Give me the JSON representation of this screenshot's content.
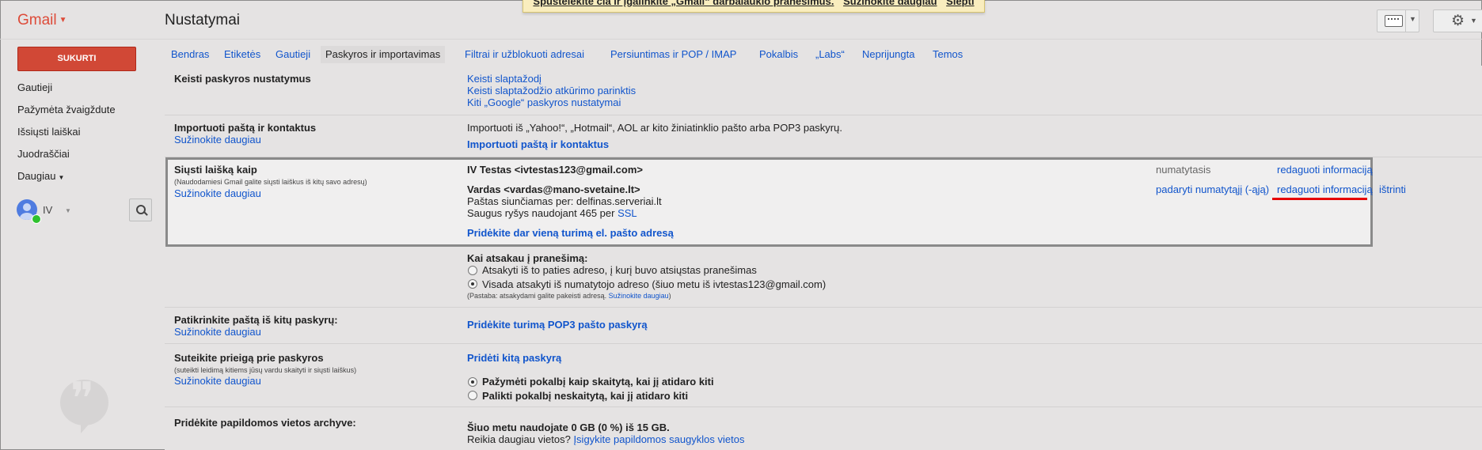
{
  "header": {
    "logo": "Gmail",
    "page_title": "Nustatymai",
    "notice": {
      "text_a": "Spustelėkite čia ir įgalinkite „Gmail“ darbalaukio pranešimus.",
      "learn_more": "Sužinokite daugiau",
      "hide": "Slėpti"
    }
  },
  "sidebar": {
    "compose": "SUKURTI",
    "items": [
      "Gautieji",
      "Pažymėta žvaigždute",
      "Išsiųsti laiškai",
      "Juodraščiai",
      "Daugiau"
    ],
    "user": "IV"
  },
  "tabs": [
    "Bendras",
    "Etiketės",
    "Gautieji",
    "Paskyros ir importavimas",
    "Filtrai ir užblokuoti adresai",
    "Persiuntimas ir POP / IMAP",
    "Pokalbis",
    "„Labs“",
    "Neprijungta",
    "Temos"
  ],
  "sections": {
    "change_account": {
      "label": "Keisti paskyros nustatymus",
      "links": [
        "Keisti slaptažodį",
        "Keisti slaptažodžio atkūrimo parinktis",
        "Kiti „Google“ paskyros nustatymai"
      ]
    },
    "import": {
      "label": "Importuoti paštą ir kontaktus",
      "learn": "Sužinokite daugiau",
      "desc": "Importuoti iš „Yahoo!“, „Hotmail“, AOL ar kito žiniatinklio pašto arba POP3 paskyrų.",
      "action": "Importuoti paštą ir kontaktus"
    },
    "send_as": {
      "label": "Siųsti laišką kaip",
      "sub": "(Naudodamiesi Gmail galite siųsti laiškus iš kitų savo adresų)",
      "learn": "Sužinokite daugiau",
      "primary": "IV Testas <ivtestas123@gmail.com>",
      "default_label": "numatytasis",
      "edit": "redaguoti informaciją",
      "secondary": "Vardas <vardas@mano-svetaine.lt>",
      "sent_via": "Paštas siunčiamas per: delfinas.serveriai.lt",
      "secure_prefix": "Saugus ryšys naudojant 465 per",
      "ssl": "SSL",
      "make_default": "padaryti numatytąjį (-ąją)",
      "edit2": "redaguoti informaciją",
      "delete": "ištrinti",
      "add": "Pridėkite dar vieną turimą el. pašto adresą"
    },
    "reply": {
      "label": "Kai atsakau į pranešimą:",
      "opt1": "Atsakyti iš to paties adreso, į kurį buvo atsiųstas pranešimas",
      "opt2": "Visada atsakyti iš numatytojo adreso (šiuo metu iš ivtestas123@gmail.com)",
      "note_prefix": "(Pastaba: atsakydami galite pakeisti adresą.",
      "note_link": "Sužinokite daugiau",
      "note_suffix": ")"
    },
    "check_mail": {
      "label": "Patikrinkite paštą iš kitų paskyrų:",
      "learn": "Sužinokite daugiau",
      "action": "Pridėkite turimą POP3 pašto paskyrą"
    },
    "grant": {
      "label": "Suteikite prieigą prie paskyros",
      "sub": "(suteikti leidimą kitiems jūsų vardu skaityti ir siųsti laiškus)",
      "learn": "Sužinokite daugiau",
      "action": "Pridėti kitą paskyrą",
      "opt1": "Pažymėti pokalbį kaip skaitytą, kai jį atidaro kiti",
      "opt2": "Palikti pokalbį neskaitytą, kai jį atidaro kiti"
    },
    "storage": {
      "label": "Pridėkite papildomos vietos archyve:",
      "usage": "Šiuo metu naudojate 0 GB (0 %) iš 15 GB.",
      "need_prefix": "Reikia daugiau vietos?",
      "buy": "Įsigykite papildomos saugyklos vietos"
    }
  }
}
